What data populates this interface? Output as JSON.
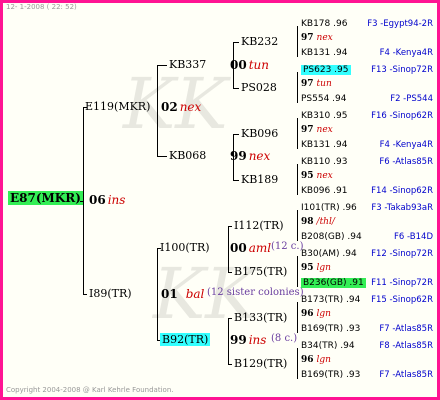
{
  "header": {
    "date": "12-  1-2008 ( 22: 52)"
  },
  "footer": {
    "copyright": "Copyright 2004-2008 @ Karl Kehrle Foundation."
  },
  "root": {
    "name": "E87(MKR)",
    "year": "06",
    "tag": "ins"
  },
  "parents": {
    "sire": {
      "name": "E119(MKR)",
      "year": "02",
      "tag": "nex"
    },
    "dam": {
      "name": "I89(TR)",
      "year": "01",
      "tag": "bal",
      "note": "(12 sister colonies)"
    }
  },
  "grandparents": {
    "g1": {
      "name": "KB337",
      "year": "00",
      "tag": "tun"
    },
    "g2": {
      "name": "KB068",
      "year": "99",
      "tag": "nex"
    },
    "g3": {
      "name": "I100(TR)",
      "year": "00",
      "tag": "aml",
      "note": "(12 c.)"
    },
    "g4": {
      "name": "B92(TR)",
      "year": "99",
      "tag": "ins",
      "note": "(8 c.)"
    }
  },
  "ggparents": {
    "a1": "KB232",
    "a2": "PS028",
    "a3": "KB096",
    "a4": "KB189",
    "a5": "I112(TR)",
    "a6": "B175(TR)",
    "a7": "B133(TR)",
    "a8": "B129(TR)"
  },
  "gg": [
    {
      "s": "KB178 .96",
      "y": "97",
      "t": "nex",
      "d": "KB131 .94",
      "sl": "F3 -Egypt94-2R",
      "dl": "F4 -Kenya4R"
    },
    {
      "s": "PS623 .95",
      "y": "97",
      "t": "tun",
      "d": "PS554 .94",
      "sl": "F13 -Sinop72R",
      "dl": "F2 -PS544"
    },
    {
      "s": "KB310 .95",
      "y": "97",
      "t": "nex",
      "d": "KB131 .94",
      "sl": "F16 -Sinop62R",
      "dl": "F4 -Kenya4R"
    },
    {
      "s": "KB110 .93",
      "y": "95",
      "t": "nex",
      "d": "KB096 .91",
      "sl": "F6 -Atlas85R",
      "dl": "F14 -Sinop62R"
    },
    {
      "s": "I101(TR) .96",
      "y": "98",
      "t": "/thl/",
      "d": "B208(GB) .94",
      "sl": "F3 -Takab93aR",
      "dl": "F6 -B14D"
    },
    {
      "s": "B30(AM) .94",
      "y": "95",
      "t": "lgn",
      "d": "B236(GB) .91",
      "sl": "F12 -Sinop72R",
      "dl": "F11 -Sinop72R"
    },
    {
      "s": "B173(TR) .94",
      "y": "96",
      "t": "lgn",
      "d": "B169(TR) .93",
      "sl": "F15 -Sinop62R",
      "dl": "F7 -Atlas85R"
    },
    {
      "s": "B34(TR) .94",
      "y": "96",
      "t": "lgn",
      "d": "B169(TR) .93",
      "sl": "F8 -Atlas85R",
      "dl": "F7 -Atlas85R"
    }
  ]
}
